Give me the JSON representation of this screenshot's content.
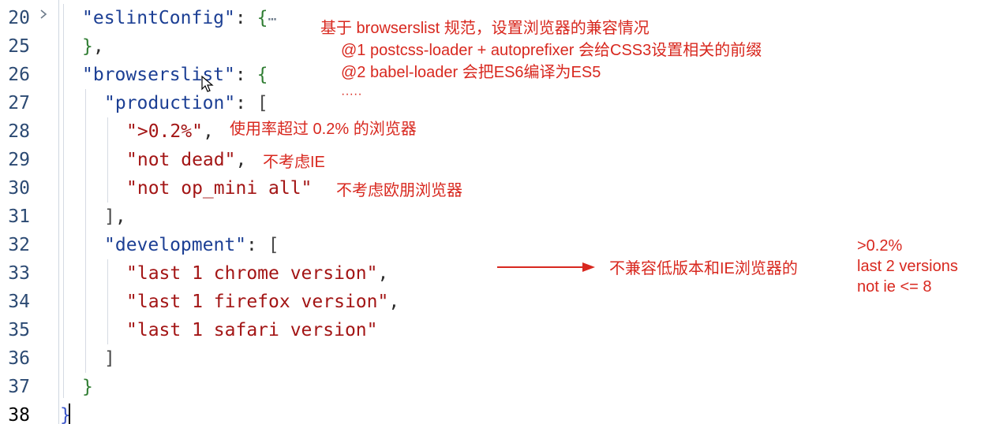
{
  "gutter": {
    "line_numbers": [
      "20",
      "25",
      "26",
      "27",
      "28",
      "29",
      "30",
      "31",
      "32",
      "33",
      "34",
      "35",
      "36",
      "37",
      "38"
    ]
  },
  "code": {
    "l20": {
      "key": "\"eslintConfig\"",
      "colon": ": ",
      "brace": "{",
      "dots": "⋯"
    },
    "l25": {
      "brace": "}",
      "comma": ","
    },
    "l26": {
      "key": "\"browserslist\"",
      "colon": ": ",
      "brace": "{"
    },
    "l27": {
      "key": "\"production\"",
      "colon": ": ",
      "bracket": "["
    },
    "l28": {
      "str": "\">0.2%\"",
      "comma": ","
    },
    "l29": {
      "str": "\"not dead\"",
      "comma": ","
    },
    "l30": {
      "str": "\"not op_mini all\""
    },
    "l31": {
      "bracket": "]",
      "comma": ","
    },
    "l32": {
      "key": "\"development\"",
      "colon": ": ",
      "bracket": "["
    },
    "l33": {
      "str": "\"last 1 chrome version\"",
      "comma": ","
    },
    "l34": {
      "str": "\"last 1 firefox version\"",
      "comma": ","
    },
    "l35": {
      "str": "\"last 1 safari version\""
    },
    "l36": {
      "bracket": "]"
    },
    "l37": {
      "brace": "}"
    },
    "l38": {
      "brace": "}"
    }
  },
  "annotations": {
    "title": "基于 browserslist 规范，设置浏览器的兼容情况",
    "note1": "@1  postcss-loader + autoprefixer 会给CSS3设置相关的前缀",
    "note2": "@2 babel-loader 会把ES6编译为ES5",
    "note3": "·····",
    "prod1": "使用率超过 0.2% 的浏览器",
    "prod2": "不考虑IE",
    "prod3": "不考虑欧朋浏览器",
    "arrow_note": "不兼容低版本和IE浏览器的",
    "alt1": ">0.2%",
    "alt2": "last 2 versions",
    "alt3": "not ie <= 8"
  },
  "colors": {
    "annotation": "#d8281f",
    "key": "#1c3f94",
    "string": "#a31515"
  }
}
